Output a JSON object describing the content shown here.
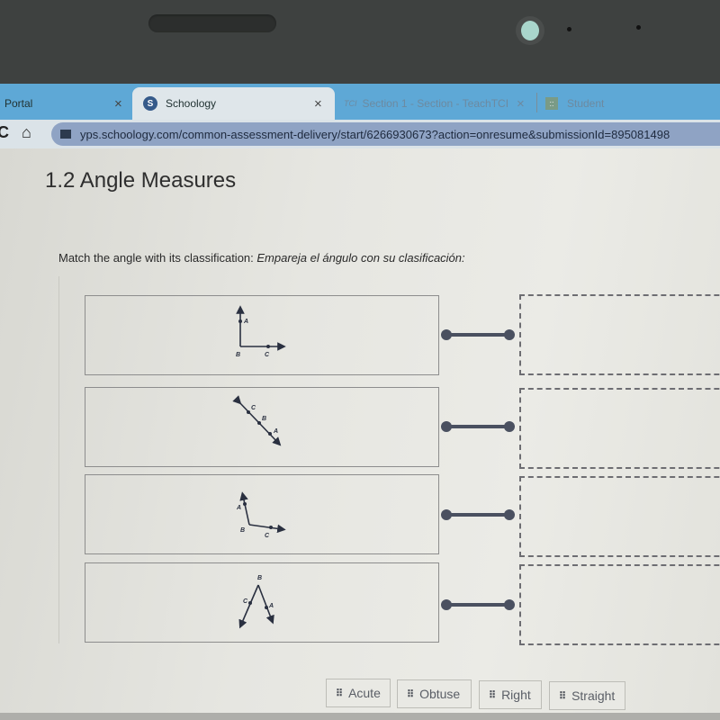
{
  "browser": {
    "tabs": [
      {
        "label": "Portal",
        "close_icon": "×"
      },
      {
        "label": "Schoology",
        "favicon": "S",
        "close_icon": "×",
        "active": true
      },
      {
        "label": "Section 1 - Section - TeachTCI",
        "favicon": "TCI",
        "close_icon": "×"
      },
      {
        "label": "Student",
        "favicon": "::"
      }
    ],
    "reload_icon": "C",
    "home_icon": "⌂",
    "url": "yps.schoology.com/common-assessment-delivery/start/6266930673?action=onresume&submissionId=895081498"
  },
  "page": {
    "title": "1.2 Angle Measures",
    "prompt_en": "Match the angle with its classification: ",
    "prompt_es": "Empareja el ángulo con su clasificación:",
    "items": [
      {
        "type": "right",
        "labels": [
          "A",
          "B",
          "C"
        ]
      },
      {
        "type": "straight",
        "labels": [
          "C",
          "B",
          "A"
        ]
      },
      {
        "type": "obtuse",
        "labels": [
          "A",
          "B",
          "C"
        ]
      },
      {
        "type": "acute",
        "labels": [
          "B",
          "C",
          "A"
        ]
      }
    ],
    "drop_targets": [
      {
        "value": ""
      },
      {
        "value": ""
      },
      {
        "value": ""
      },
      {
        "value": ""
      }
    ],
    "choices": [
      {
        "label": "Acute",
        "grip_icon": "⠿"
      },
      {
        "label": "Obtuse",
        "grip_icon": "⠿"
      },
      {
        "label": "Right",
        "grip_icon": "⠿"
      },
      {
        "label": "Straight",
        "grip_icon": "⠿"
      }
    ]
  }
}
